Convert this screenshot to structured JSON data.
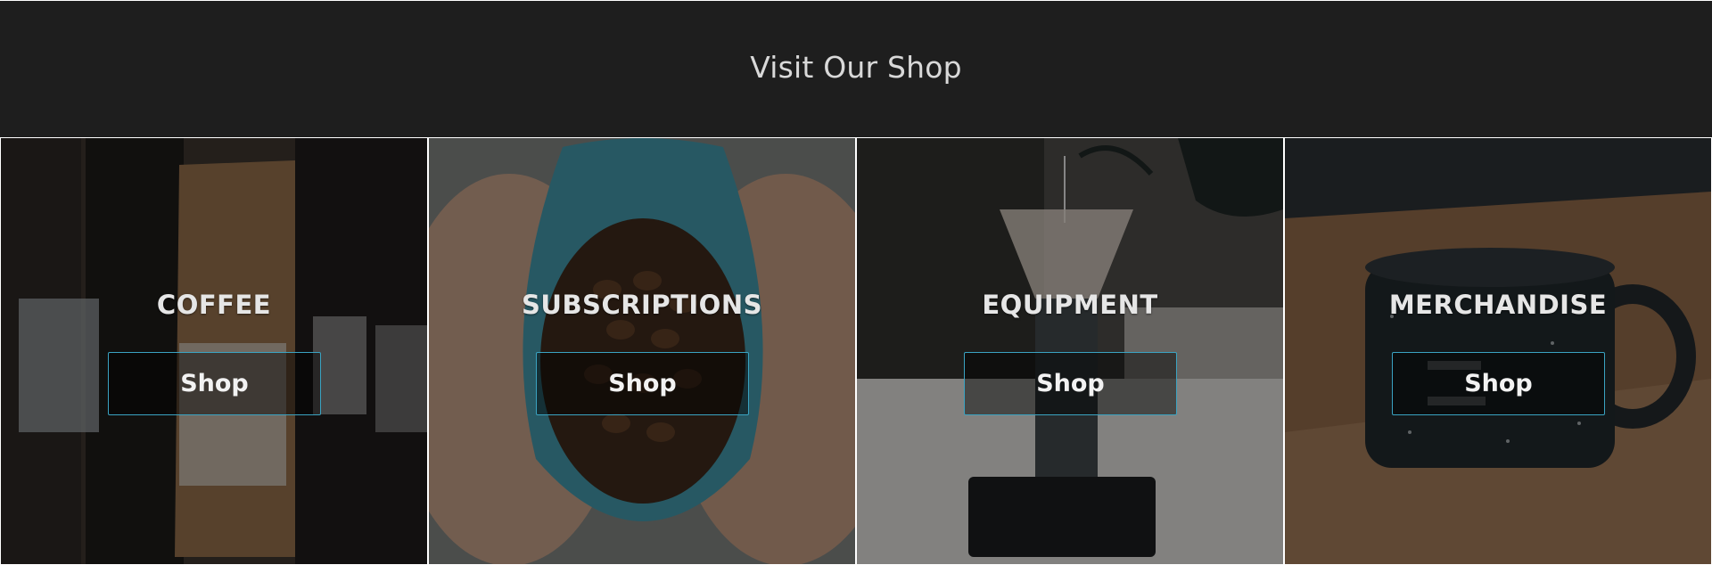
{
  "header": {
    "title": "Visit Our Shop"
  },
  "tiles": [
    {
      "title": "COFFEE",
      "button": "Shop"
    },
    {
      "title": "SUBSCRIPTIONS",
      "button": "Shop"
    },
    {
      "title": "EQUIPMENT",
      "button": "Shop"
    },
    {
      "title": "MERCHANDISE",
      "button": "Shop"
    }
  ],
  "colors": {
    "header_bg": "#1e1e1e",
    "title_text": "#d9d9d9",
    "button_border": "#3aa3c2"
  }
}
